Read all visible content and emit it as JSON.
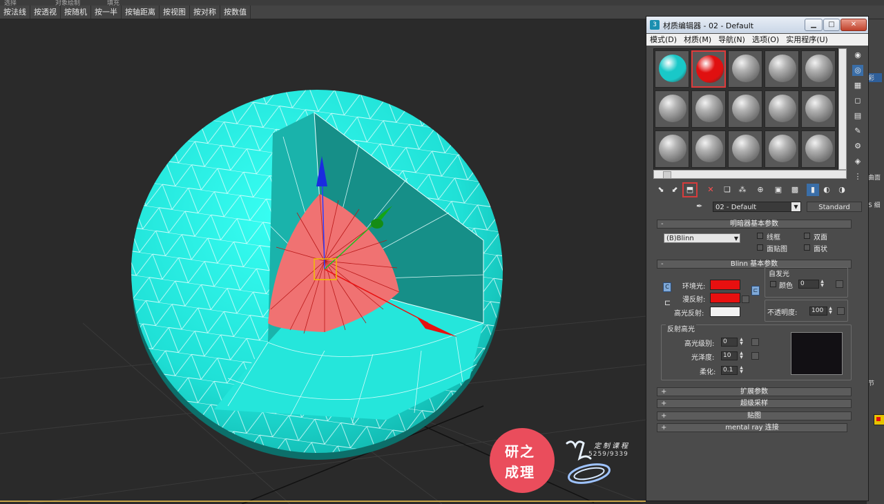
{
  "top_strip": [
    "选择",
    "对象绘制",
    "填充"
  ],
  "snap_buttons": [
    "按法线",
    "按透视",
    "按随机",
    "按一半",
    "按轴距离",
    "按视图",
    "按对称",
    "按数值"
  ],
  "material_editor": {
    "title": "材质编辑器 - 02 - Default",
    "menus": [
      "模式(D)",
      "材质(M)",
      "导航(N)",
      "选项(O)",
      "实用程序(U)"
    ],
    "slots": {
      "rows": 3,
      "cols": 5,
      "colored": [
        {
          "index": 0,
          "color": "#19c8c8"
        },
        {
          "index": 1,
          "color": "#e01010"
        }
      ],
      "active_index": 1
    },
    "material_name": "02 - Default",
    "material_type": "Standard",
    "shader_basic": {
      "header": "明暗器基本参数",
      "shader": "(B)Blinn",
      "options": [
        "线框",
        "双面",
        "面贴图",
        "面状"
      ]
    },
    "blinn_basic": {
      "header": "Blinn 基本参数",
      "ambient_label": "环境光:",
      "diffuse_label": "漫反射:",
      "specular_label": "高光反射:",
      "ambient_color": "#e81010",
      "diffuse_color": "#e81010",
      "specular_color": "#f2f2f2",
      "self_illum_title": "自发光",
      "self_illum_color_label": "颜色",
      "self_illum_value": "0",
      "opacity_label": "不透明度:",
      "opacity_value": "100"
    },
    "specular_highlights": {
      "title": "反射高光",
      "level_label": "高光级别:",
      "level_value": "0",
      "gloss_label": "光泽度:",
      "gloss_value": "10",
      "soften_label": "柔化:",
      "soften_value": "0.1"
    },
    "collapsed_rollouts": [
      "扩展参数",
      "超级采样",
      "贴图",
      "mental ray 连接"
    ]
  },
  "command_panel": [
    "彩",
    "曲面",
    "S 细",
    "节"
  ],
  "watermark": {
    "line1": "研之",
    "line2": "成理",
    "sub1": "定制课程",
    "sub2": "5259/9339",
    "color": "#ea4d5c"
  },
  "scene": {
    "sphere_color": "#1fe0d6",
    "cut_color": "#1aa8a0",
    "core_color": "#f07070"
  }
}
